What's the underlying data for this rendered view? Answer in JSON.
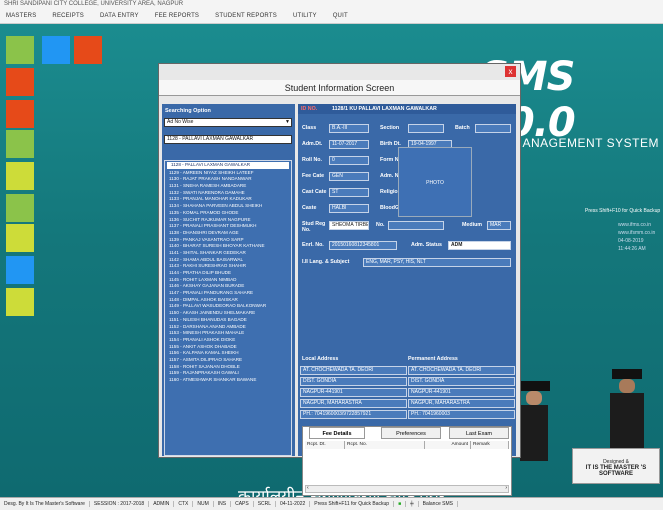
{
  "app": {
    "title_strip": "SHRI SANDIPANI CITY COLLEGE, UNIVERSITY AREA, NAGPUR"
  },
  "menu": [
    "MASTERS",
    "RECEIPTS",
    "DATA ENTRY",
    "FEE REPORTS",
    "STUDENT REPORTS",
    "UTILITY",
    "QUIT"
  ],
  "branding": {
    "logo": "SMS 10.0",
    "subtitle": "MANAGEMENT SYSTEM",
    "backup_hint": "Press Shift+F10 for Quick Backup",
    "links": [
      "www.ifms.co.in",
      "www.ifsmm.co.in",
      "04-08-2019 11:44:26 AM"
    ],
    "hindi_banner": "कार्यालयीन संगणीकरण सॉफ्टवेयर",
    "master_small": "Designed &",
    "master_text": "IT IS THE MASTER 'S SOFTWARE"
  },
  "tiles": [
    {
      "color": "#8bc34a"
    },
    {
      "color": "#2196f3"
    },
    {
      "color": "#e64a19"
    },
    {
      "color": "#e64a19"
    },
    {
      "color": "#e64a19"
    },
    {
      "color": "#8bc34a"
    },
    {
      "color": "#cddc39"
    },
    {
      "color": "#8bc34a"
    },
    {
      "color": "#cddc39"
    },
    {
      "color": "#2196f3"
    },
    {
      "color": "#cddc39"
    }
  ],
  "window": {
    "title": "Student Information Screen",
    "close": "x",
    "search_label": "Searching Option",
    "search_by": "Ad No Wise",
    "search_value": "1128 - PALLAVI LAXMAN GAWALKAR",
    "list": [
      "1128 - PALLAVI LAXMAN GAWALKAR",
      "1129 - AMREEN NIYAZ SHEIKH LATEEF",
      "1130 - RAJAT PRAKASH NANDANWAR",
      "1131 - SNEHA RAMESH AMBADARE",
      "1132 - SWATI NARENDRA DAMAHE",
      "1133 - PRANJAL MANOHAR KADUKAR",
      "1134 - SHAHANA PARVEEN ABDUL SHEIKH",
      "1135 - KOMAL PRAMOD GHODE",
      "1136 - SUCHIT RAJKUMAR NAGPURE",
      "1137 - PRANALI PRASHANT DESHMUKH",
      "1138 - DHANSHRI DEVRAM AGE",
      "1139 - PANKAJ VASANTRAO SARP",
      "1140 - BHARAT SURESH BHOYAR KATHANE",
      "1141 - SHITAL SHANKAR GEDEKAR",
      "1142 - SHAMA ABDUL BAISARWAL",
      "1143 - RAKHI SURESHRAO SHAHIR",
      "1144 - PRATHA DILIP BHUDE",
      "1145 - ROHIT LAXMAN NIMBAD",
      "1146 - AKSHAY GAJANAN BURADE",
      "1147 - PRANALI PANDURANG SAHARE",
      "1148 - DIMPAL ASHOK BAISKAR",
      "1149 - PALLAVI WASUDEORAO BALKONWAR",
      "1150 - AKASH JAINENDU SHELMAKARE",
      "1151 - NILESH BHANUDAS BAGADE",
      "1152 - DARSHANA ANAND AMBADE",
      "1153 - MINESH PRAKASH MAHALE",
      "1154 - PRANALI ASHOK DIOKE",
      "1155 - ANKIT ASHOK DHABADE",
      "1156 - KALPANA KAMAL SHEIKH",
      "1157 - ASMITA DILIPRAO SAHARE",
      "1158 - ROHIT SAJANAN DHOBLE",
      "1159 - RAJANPRAKASH GAWALI",
      "1160 - ATMESHWAR SHANKAR BAWANE"
    ],
    "header_id": "1128",
    "header_line": "1128/1   KU PALLAVI LAXMAN GAWALKAR",
    "fields": {
      "class_label": "Class",
      "class_value": "B.A.-III",
      "section_label": "Section",
      "section_value": "",
      "batch_label": "Batch",
      "batch_value": "",
      "adm_dt_label": "Adm.Dt.",
      "adm_dt_value": "11-07-2017",
      "birth_dt_label": "Birth Dt.",
      "birth_dt_value": "19-04-1997",
      "roll_label": "Roll No.",
      "roll_value": "0",
      "form_label": "Form No.",
      "form_value": "",
      "fee_cate_label": "Fee Cate",
      "fee_cate_value": "GEN",
      "adm_no_label": "Adm. No.",
      "adm_no_value": "0",
      "cast_cate_label": "Cast Cate",
      "cast_cate_value": "ST",
      "religion_label": "Religion",
      "religion_value": "",
      "caste_label": "Caste",
      "caste_value": "HALBI",
      "bloodgp_label": "BloodGp",
      "bloodgp_value": "",
      "stud_reg_label": "Stud Reg No.",
      "stud_reg_value": "SHEOMA TIRBE",
      "no_label": "No.",
      "no_value": "",
      "medium_label": "Medium",
      "medium_value": "MAR",
      "enrl_label": "Enrl. No.",
      "enrl_value": "20150160812345801",
      "status_label": "Adm. Status",
      "status_value": "ADM",
      "subject_label": "I.II Lang. & Subject",
      "subject_value": "ENG, MAR, PSY, HIS, NLT",
      "photo": "PHOTO"
    },
    "local_address": {
      "label": "Local Address",
      "lines": [
        "AT. CHOCHEWADA TA. DEORI",
        "DIST. GONDIA",
        "NAGPUR-441901",
        "NAGPUR, MAHARASTRA",
        "PH.: 7041960003/9722857921"
      ]
    },
    "permanent_address": {
      "label": "Permanent Address",
      "lines": [
        "AT. CHOCHEWADA TA. DEORI",
        "DIST. GONDIA",
        "NAGPUR-441901",
        "NAGPUR, MAHARASTRA",
        "PH.: 7041960003"
      ]
    },
    "tabs": [
      "Fee Details",
      "Preferences",
      "Last Exam"
    ],
    "columns": [
      "Rcpt. Dt.",
      "Rcpt. No.",
      "Amount",
      "Remark"
    ]
  },
  "status_bar": [
    "Desg. By It Is The Master's Software",
    "SESSION : 2017-2018",
    "ADMIN",
    "CTX",
    "NUM",
    "INS",
    "CAPS",
    "SCRL",
    "04-11-2022",
    "Press Shift+F11 for Quick Backup",
    "Balance SMS"
  ]
}
